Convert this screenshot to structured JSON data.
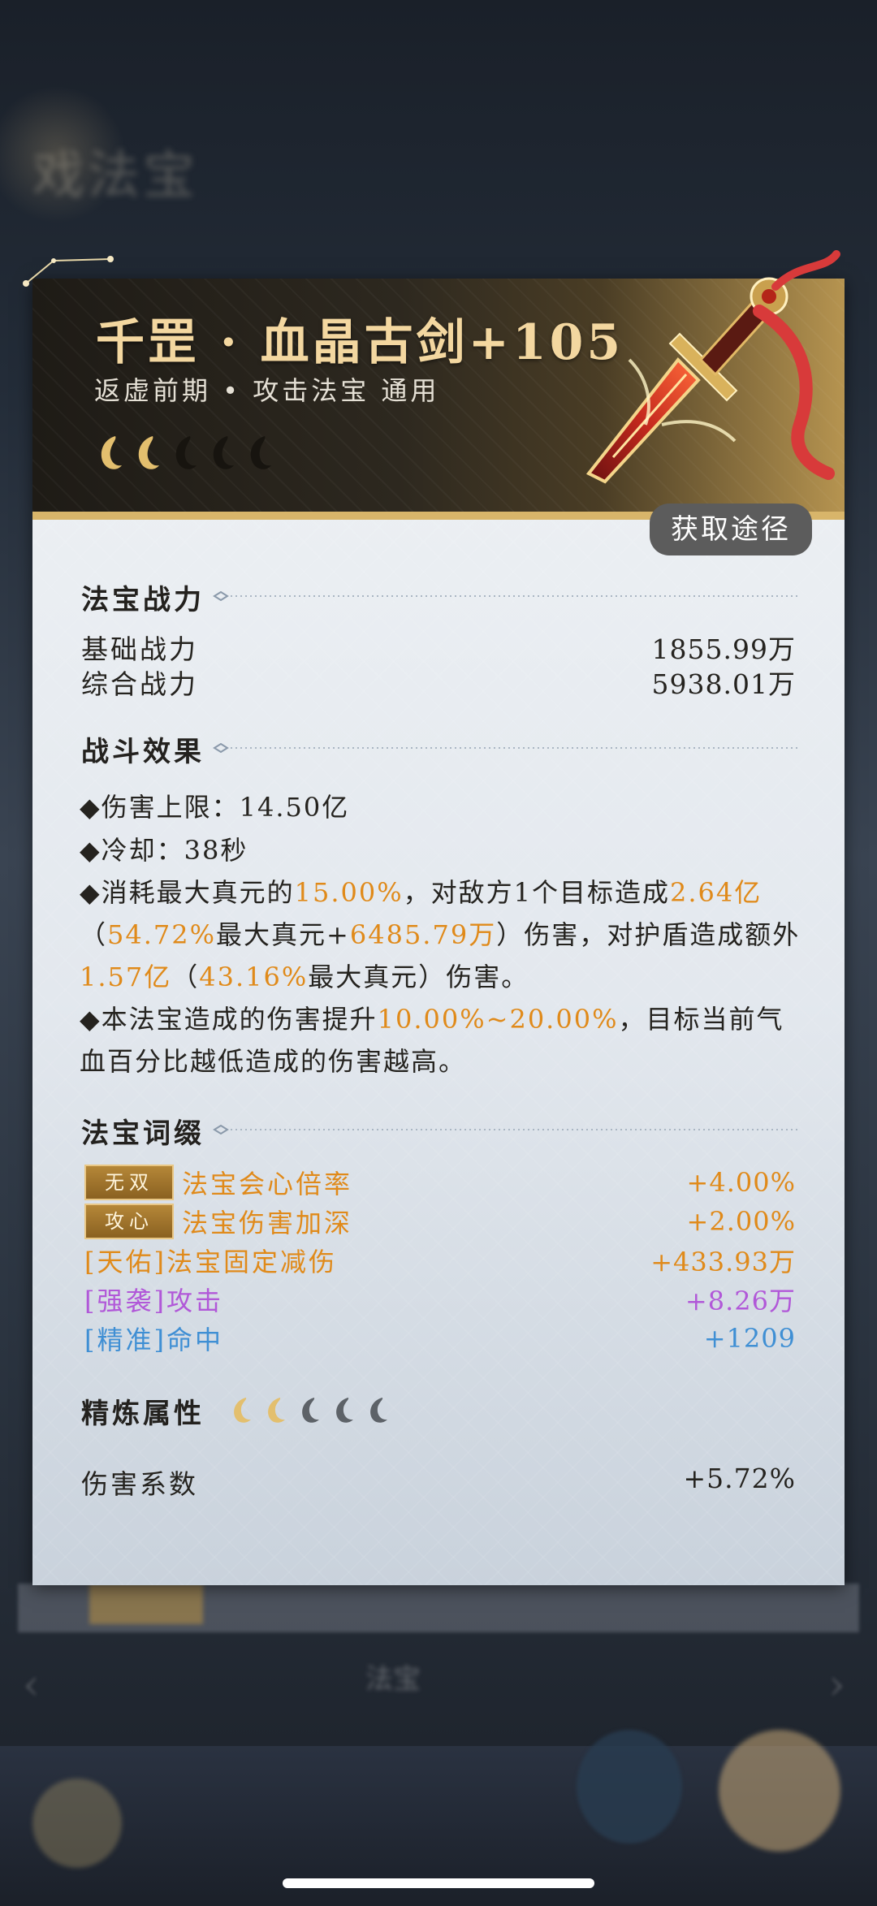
{
  "header": {
    "title": "千罡 · 血晶古剑+105",
    "subtitle": "返虚前期 • 攻击法宝 通用",
    "stars_total": 5,
    "stars_filled": 2,
    "get_route_label": "获取途径"
  },
  "power": {
    "title": "法宝战力",
    "rows": [
      {
        "label": "基础战力",
        "value": "1855.99万"
      },
      {
        "label": "综合战力",
        "value": "5938.01万"
      }
    ]
  },
  "effects": {
    "title": "战斗效果",
    "damage_cap": "◆伤害上限：14.50亿",
    "cooldown": "◆冷却：38秒",
    "e1_a": "◆消耗最大真元的",
    "e1_b": "15.00%",
    "e1_c": "，对敌方1个目标造成",
    "e1_d": "2.64亿",
    "e1_e": "（",
    "e1_f": "54.72%",
    "e1_g": "最大真元+",
    "e1_h": "6485.79万",
    "e1_i": "）伤害，对护盾造成额外",
    "e1_j": "1.57亿",
    "e1_k": "（",
    "e1_l": "43.16%",
    "e1_m": "最大真元）伤害。",
    "e2_a": "◆本法宝造成的伤害提升",
    "e2_b": "10.00%~20.00%",
    "e2_c": "，目标当前气血百分比越低造成的伤害越高。"
  },
  "affixes": {
    "title": "法宝词缀",
    "rows": [
      {
        "badge": "无双",
        "name": "法宝会心倍率",
        "value": "+4.00%",
        "color": "#e08a1a"
      },
      {
        "badge": "攻心",
        "name": "法宝伤害加深",
        "value": "+2.00%",
        "color": "#e08a1a"
      },
      {
        "name": "[天佑]法宝固定减伤",
        "value": "+433.93万",
        "color": "#e08a1a"
      },
      {
        "name": "[强袭]攻击",
        "value": "+8.26万",
        "color": "#b158d8"
      },
      {
        "name": "[精准]命中",
        "value": "+1209",
        "color": "#3f8fd4"
      }
    ]
  },
  "refine": {
    "title": "精炼属性",
    "stars_total": 5,
    "stars_filled": 2,
    "rows": [
      {
        "label": "伤害系数",
        "value": "+5.72%"
      }
    ]
  },
  "colors": {
    "accent_orange": "#e08a1a",
    "accent_purple": "#b158d8",
    "accent_blue": "#3f8fd4",
    "title_gold": "#f3d7a0"
  }
}
